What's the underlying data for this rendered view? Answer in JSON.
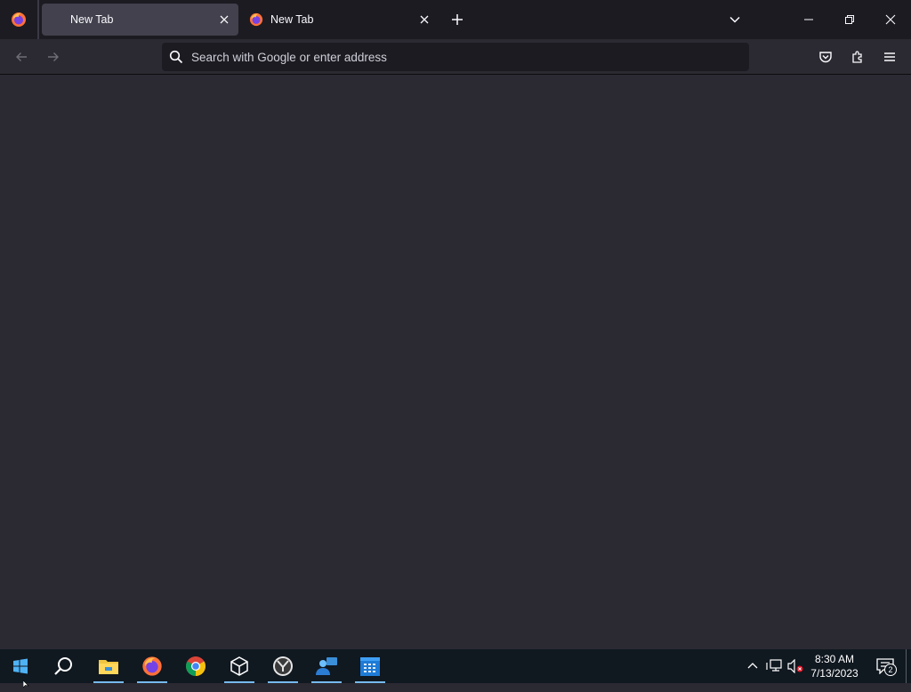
{
  "browser": {
    "tabs": [
      {
        "label": "New Tab",
        "active": true
      },
      {
        "label": "New Tab",
        "active": false
      }
    ],
    "address_bar": {
      "placeholder": "Search with Google or enter address",
      "value": ""
    },
    "icons": {
      "app_menu": "firefox-logo-icon",
      "new_tab": "plus-icon",
      "list_all_tabs": "chevron-down-icon",
      "minimize": "minimize-icon",
      "restore": "restore-icon",
      "close": "close-icon",
      "back": "back-arrow-icon",
      "forward": "forward-arrow-icon",
      "pocket": "pocket-icon",
      "extensions": "puzzle-icon",
      "menu": "hamburger-menu-icon"
    }
  },
  "taskbar": {
    "apps": [
      "windows-start-icon",
      "search-icon",
      "file-explorer-icon",
      "firefox-icon",
      "chrome-icon",
      "3d-viewer-icon",
      "clock-app-icon",
      "people-icon",
      "calendar-icon"
    ],
    "clock": {
      "time": "8:30 AM",
      "date": "7/13/2023"
    },
    "notifications": {
      "count": "2"
    }
  },
  "colors": {
    "toolbar_bg": "#2b2a33",
    "tabstrip_bg": "#1c1b22",
    "active_tab_bg": "#42414d",
    "taskbar_bg": "#101820",
    "accent": "#76b9ed"
  }
}
